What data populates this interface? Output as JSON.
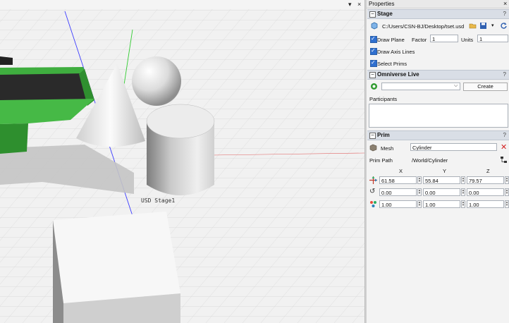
{
  "viewport": {
    "menu_icon": "▾",
    "close_icon": "×",
    "stage_label": "USD Stage1"
  },
  "panel": {
    "title": "Properties",
    "close_icon": "×",
    "stage": {
      "title": "Stage",
      "help": "?",
      "file_path": "C:/Users/CSN-BJ/Desktop/tset.usd",
      "draw_plane_label": "Draw Plane",
      "draw_plane_checked": true,
      "factor_label": "Factor",
      "factor_value": "1",
      "units_label": "Units",
      "units_value": "1",
      "draw_axis_lines_label": "Draw Axis Lines",
      "draw_axis_lines_checked": true,
      "select_prims_label": "Select Prims",
      "select_prims_checked": true
    },
    "live": {
      "title": "Omniverse Live",
      "help": "?",
      "server_value": "",
      "create_label": "Create",
      "participants_label": "Participants"
    },
    "prim": {
      "title": "Prim",
      "help": "?",
      "type_label": "Mesh",
      "name_value": "Cylinder",
      "path_label": "Prim Path",
      "path_value": "/World/Cylinder",
      "col_x": "X",
      "col_y": "Y",
      "col_z": "Z",
      "translate": [
        "61.58",
        "55.84",
        "79.57"
      ],
      "rotate": [
        "0.00",
        "0.00",
        "0.00"
      ],
      "scale": [
        "1.00",
        "1.00",
        "1.00"
      ]
    }
  },
  "colors": {
    "section_header": "#d9dee6",
    "checkbox": "#2f6fcf",
    "delete_red": "#d42020",
    "live_green": "#2e9a2e"
  }
}
